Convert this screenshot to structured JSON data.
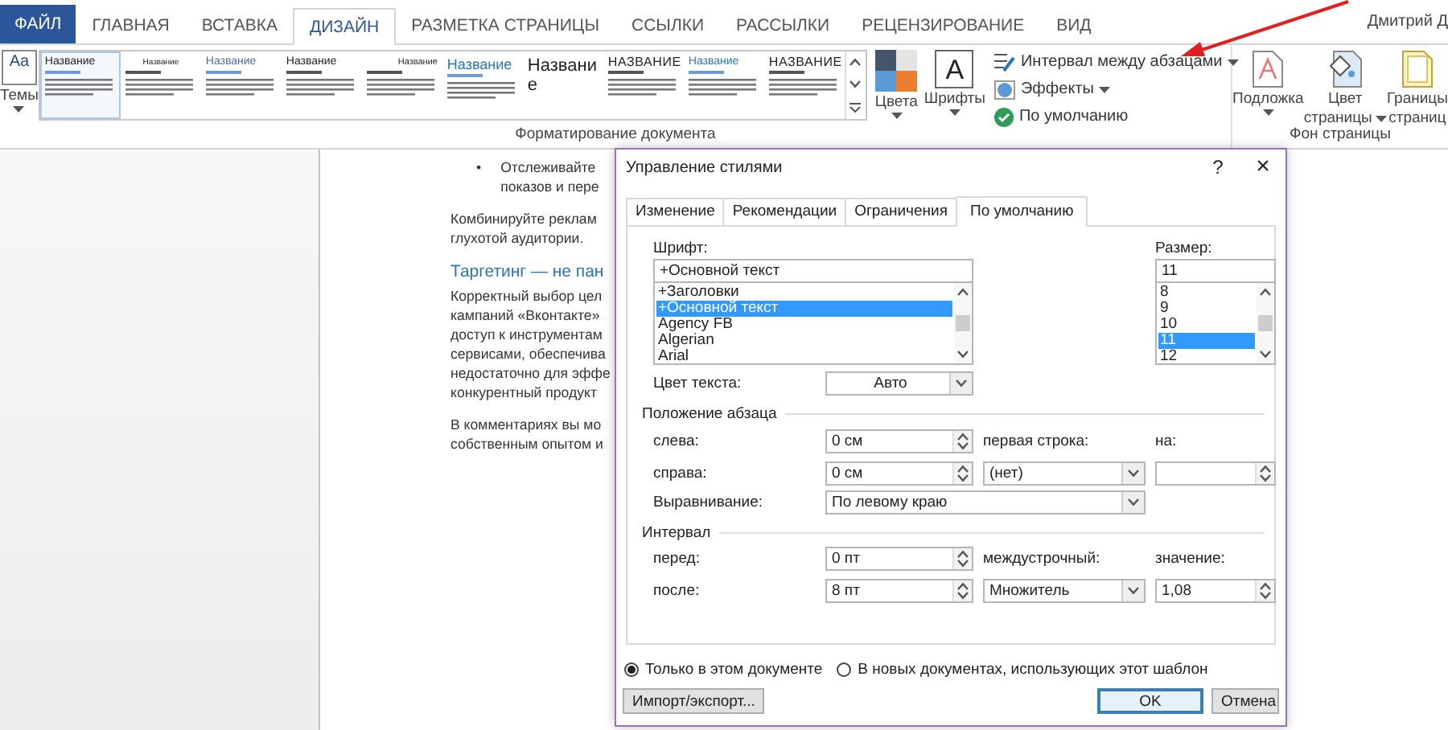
{
  "ribbon_tabs": [
    {
      "label": "ФАЙЛ",
      "kind": "file",
      "selected": false
    },
    {
      "label": "ГЛАВНАЯ",
      "kind": "tab",
      "selected": false
    },
    {
      "label": "ВСТАВКА",
      "kind": "tab",
      "selected": false
    },
    {
      "label": "ДИЗАЙН",
      "kind": "tab",
      "selected": true
    },
    {
      "label": "РАЗМЕТКА СТРАНИЦЫ",
      "kind": "tab",
      "selected": false
    },
    {
      "label": "ССЫЛКИ",
      "kind": "tab",
      "selected": false
    },
    {
      "label": "РАССЫЛКИ",
      "kind": "tab",
      "selected": false
    },
    {
      "label": "РЕЦЕНЗИРОВАНИЕ",
      "kind": "tab",
      "selected": false
    },
    {
      "label": "ВИД",
      "kind": "tab",
      "selected": false
    }
  ],
  "user": "Дмитрий Д",
  "document_formatting": {
    "themes": {
      "label": "Темы",
      "icon_text": "Aa",
      "dropdown": true
    },
    "style_gallery": [
      {
        "title": "Название",
        "kind": "classic",
        "selected": true
      },
      {
        "title": "Название",
        "kind": "compact",
        "selected": false
      },
      {
        "title": "Название",
        "kind": "light",
        "selected": false
      },
      {
        "title": "Название",
        "kind": "basic",
        "selected": false
      },
      {
        "title": "Название",
        "kind": "right",
        "selected": false
      },
      {
        "title": "Название",
        "kind": "blue-large",
        "selected": false
      },
      {
        "title": "Название",
        "kind": "large",
        "selected": false
      },
      {
        "title": "НАЗВАНИЕ",
        "kind": "caps",
        "selected": false
      },
      {
        "title": "Название",
        "kind": "blue",
        "selected": false
      },
      {
        "title": "НАЗВАНИЕ",
        "kind": "caps",
        "selected": false
      }
    ],
    "buttons": [
      {
        "label": "Цвета",
        "kind": "colors",
        "dropdown": true
      },
      {
        "label": "Шрифты",
        "kind": "fonts",
        "icon_text": "A",
        "dropdown": true
      }
    ],
    "commands": [
      {
        "label": "Интервал между абзацами",
        "kind": "spacing",
        "dropdown": true
      },
      {
        "label": "Эффекты",
        "kind": "effects",
        "dropdown": true
      },
      {
        "label": "По умолчанию",
        "kind": "default",
        "dropdown": false
      }
    ],
    "group_label": "Форматирование документа"
  },
  "page_background": {
    "buttons": [
      {
        "lines": [
          "Подложка"
        ],
        "kind": "watermark",
        "dropdown": true
      },
      {
        "lines": [
          "Цвет",
          "страницы"
        ],
        "kind": "page-color",
        "dropdown": true
      },
      {
        "lines": [
          "Границы",
          "страниц"
        ],
        "kind": "borders",
        "dropdown": false
      }
    ],
    "group_label": "Фон страницы"
  },
  "document": [
    {
      "kind": "bullet",
      "bullet": "•",
      "lines": [
        "Отслеживайте",
        "показов и пере"
      ]
    },
    {
      "kind": "paragraph",
      "lines": [
        "Комбинируйте реклам",
        "глухотой аудитории."
      ]
    },
    {
      "kind": "heading",
      "lines": [
        "Таргетинг — не пан"
      ]
    },
    {
      "kind": "paragraph",
      "lines": [
        "Корректный выбор цел",
        "кампаний «Вконтакте»",
        "доступ к инструментам",
        "сервисами, обеспечива",
        "недостаточно для эффе",
        "конкурентный продукт"
      ]
    },
    {
      "kind": "paragraph",
      "lines": [
        "В комментариях вы мо",
        "собственным опытом и"
      ]
    }
  ],
  "dialog": {
    "title": "Управление стилями",
    "help": "?",
    "close": "×",
    "tabs": [
      {
        "label": "Изменение",
        "selected": false
      },
      {
        "label": "Рекомендации",
        "selected": false
      },
      {
        "label": "Ограничения",
        "selected": false
      },
      {
        "label": "По умолчанию",
        "selected": true
      }
    ],
    "font": {
      "label": "Шрифт:",
      "value": "+Основной текст",
      "options": [
        {
          "label": "+Заголовки",
          "selected": false
        },
        {
          "label": "+Основной текст",
          "selected": true
        },
        {
          "label": "Agency FB",
          "selected": false
        },
        {
          "label": "Algerian",
          "selected": false
        },
        {
          "label": "Arial",
          "selected": false
        }
      ]
    },
    "size": {
      "label": "Размер:",
      "value": "11",
      "options": [
        {
          "label": "8",
          "selected": false
        },
        {
          "label": "9",
          "selected": false
        },
        {
          "label": "10",
          "selected": false
        },
        {
          "label": "11",
          "selected": true
        },
        {
          "label": "12",
          "selected": false
        }
      ]
    },
    "text_color": {
      "label": "Цвет текста:",
      "value": "Авто"
    },
    "paragraph_position": {
      "title": "Положение абзаца",
      "left": {
        "label": "слева:",
        "value": "0 см"
      },
      "right": {
        "label": "справа:",
        "value": "0 см"
      },
      "first_line": {
        "label": "первая строка:",
        "value": "(нет)"
      },
      "by": {
        "label": "на:"
      },
      "alignment": {
        "label": "Выравнивание:",
        "value": "По левому краю"
      }
    },
    "spacing": {
      "title": "Интервал",
      "before": {
        "label": "перед:",
        "value": "0 пт"
      },
      "after": {
        "label": "после:",
        "value": "8 пт"
      },
      "line_spacing": {
        "label": "междустрочный:",
        "value": "Множитель"
      },
      "at": {
        "label": "значение:",
        "value": "1,08"
      }
    },
    "scope": [
      {
        "label": "Только в этом документе",
        "selected": true
      },
      {
        "label": "В новых документах, использующих этот шаблон",
        "selected": false
      }
    ],
    "buttons": [
      {
        "label": "Импорт/экспорт...",
        "kind": "secondary"
      },
      {
        "label": "OK",
        "kind": "default"
      },
      {
        "label": "Отмена",
        "kind": "secondary"
      }
    ]
  }
}
